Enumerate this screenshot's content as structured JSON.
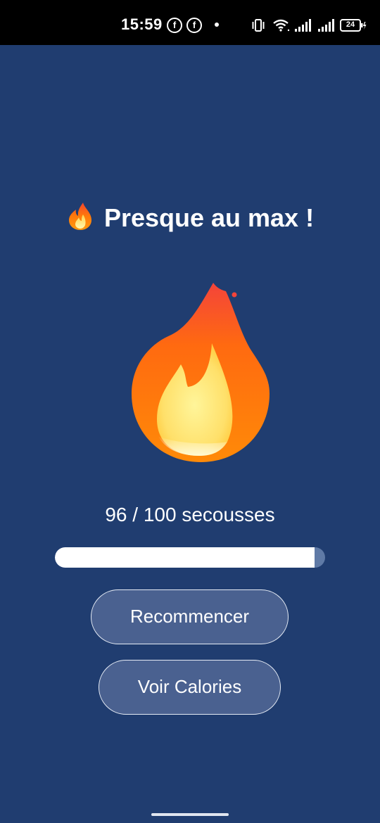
{
  "status_bar": {
    "time": "15:59",
    "notification_icons": [
      "facebook-icon",
      "facebook-icon"
    ],
    "battery_level": "24"
  },
  "main": {
    "title": "Presque au max !",
    "title_emoji": "fire-icon",
    "shake_count": "96 / 100 secousses",
    "progress_fraction": 0.96,
    "buttons": {
      "restart_label": "Recommencer",
      "calories_label": "Voir Calories"
    }
  },
  "colors": {
    "background": "#203d70",
    "button_bg": "#4a6190",
    "progress_fill": "#ffffff",
    "progress_track": "#5f7aa6"
  }
}
